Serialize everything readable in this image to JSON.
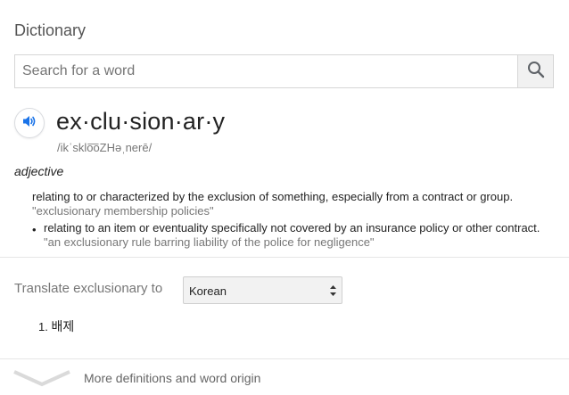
{
  "header": {
    "title": "Dictionary"
  },
  "search": {
    "placeholder": "Search for a word",
    "value": ""
  },
  "entry": {
    "word": "ex·clu·sion·ar·y",
    "phonetic": "/ikˈsklo͞oZHəˌnerē/",
    "part_of_speech": "adjective",
    "definitions": [
      {
        "text": "relating to or characterized by the exclusion of something, especially from a contract or group.",
        "example": "\"exclusionary membership policies\""
      },
      {
        "text": "relating to an item or eventuality specifically not covered by an insurance policy or other contract.",
        "example": "\"an exclusionary rule barring liability of the police for negligence\""
      }
    ]
  },
  "translate": {
    "label": "Translate exclusionary to",
    "language": "Korean",
    "results": [
      {
        "index": "1.",
        "text": "배제"
      }
    ]
  },
  "footer": {
    "more_label": "More definitions and word origin"
  },
  "colors": {
    "accent": "#1a73e8",
    "secondary_text": "#777777"
  },
  "icons": [
    "search-icon",
    "speaker-icon",
    "select-arrows-icon",
    "chevron-down-icon"
  ]
}
